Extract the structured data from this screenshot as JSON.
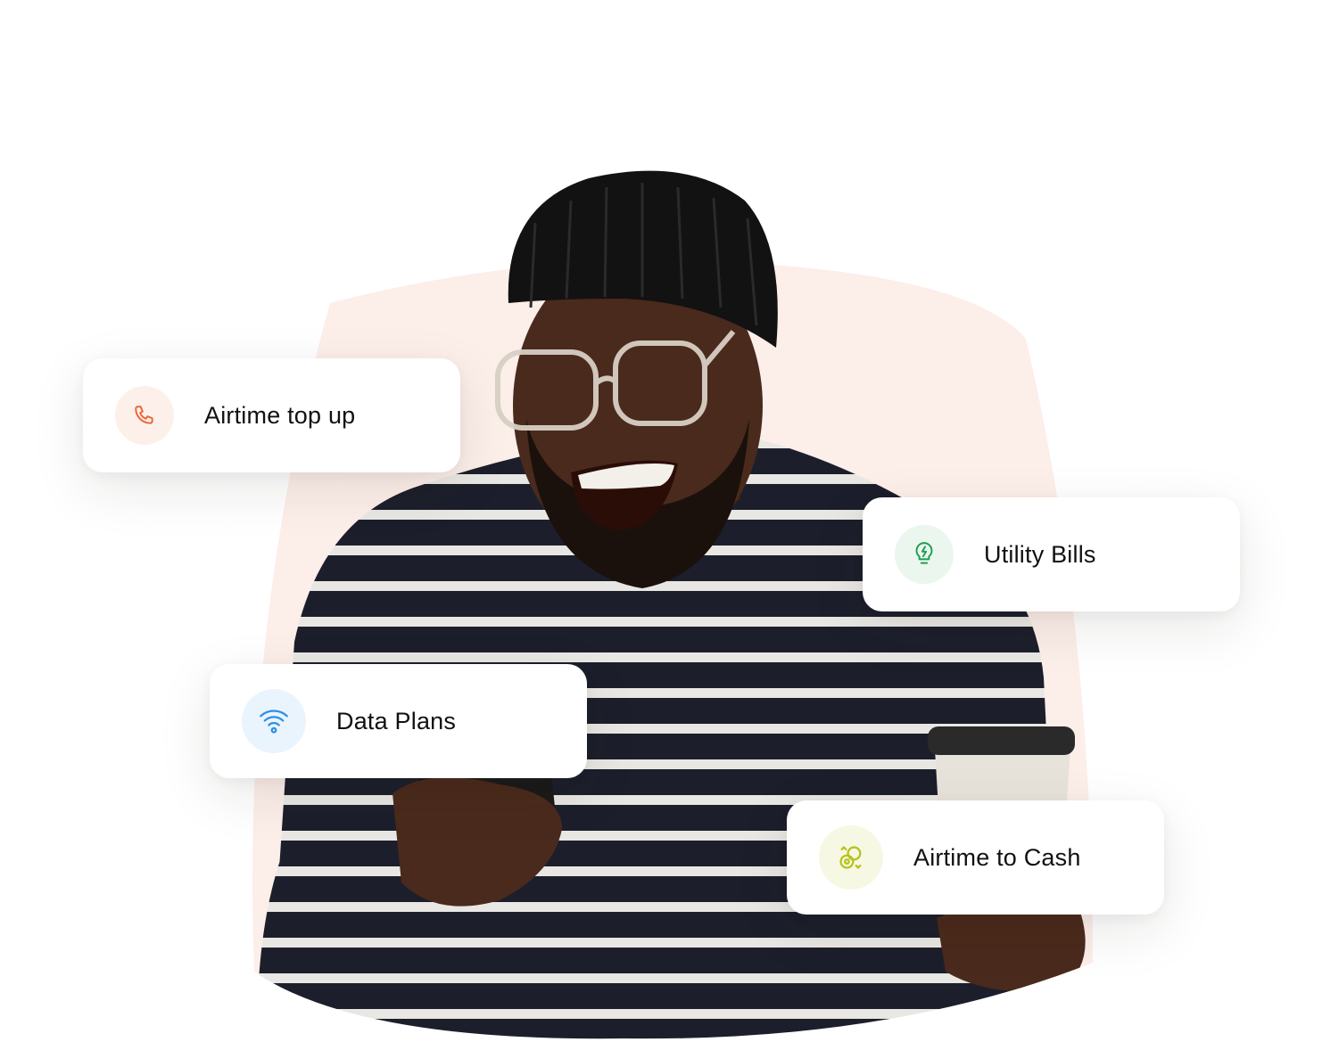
{
  "services": {
    "airtime_top_up": {
      "label": "Airtime top up",
      "icon": "phone-icon",
      "accent": "#E8673A",
      "icon_bg": "#FDF0EA"
    },
    "utility_bills": {
      "label": "Utility Bills",
      "icon": "lightbulb-bolt-icon",
      "accent": "#1E9E55",
      "icon_bg": "#EAF6EE"
    },
    "data_plans": {
      "label": "Data Plans",
      "icon": "wifi-icon",
      "accent": "#2E8FE6",
      "icon_bg": "#EAF4FD"
    },
    "airtime_to_cash": {
      "label": "Airtime to Cash",
      "icon": "coins-exchange-icon",
      "accent": "#B7C21A",
      "icon_bg": "#F6F8E3"
    }
  },
  "hero": {
    "image": "smiling-man-with-phone-and-coffee",
    "backdrop_color": "#FCEEE9"
  }
}
